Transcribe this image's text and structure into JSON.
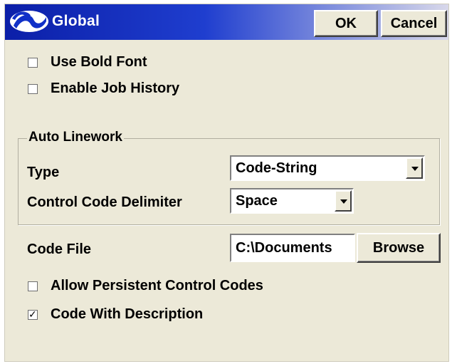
{
  "window": {
    "title": "Global",
    "ok_label": "OK",
    "cancel_label": "Cancel",
    "title_icon": "app-logo-icon"
  },
  "options": {
    "use_bold_font": {
      "label": "Use Bold Font",
      "checked": false
    },
    "enable_job_history": {
      "label": "Enable Job History",
      "checked": false
    },
    "allow_persistent_control_codes": {
      "label": "Allow Persistent Control Codes",
      "checked": false
    },
    "code_with_description": {
      "label": "Code With Description",
      "checked": true,
      "check_mark": "✓"
    }
  },
  "auto_linework": {
    "legend": "Auto Linework",
    "type_label": "Type",
    "type_value": "Code-String",
    "delimiter_label": "Control Code Delimiter",
    "delimiter_value": "Space"
  },
  "code_file": {
    "label": "Code File",
    "value": "C:\\Documents",
    "browse_label": "Browse"
  },
  "colors": {
    "titlebar_start": "#0b1fa8",
    "titlebar_end": "#d8d8ea",
    "dialog_bg": "#ece9d8"
  }
}
